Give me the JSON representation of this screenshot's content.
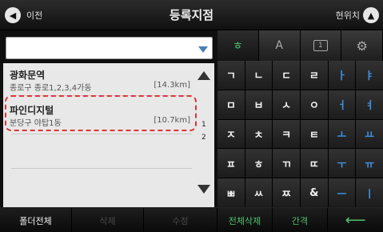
{
  "header": {
    "back_label": "이전",
    "title": "등록지점",
    "current_pos_label": "현위치"
  },
  "search": {
    "value": ""
  },
  "list": {
    "items": [
      {
        "name": "광화문역",
        "address": "종로구 종로1,2,3,4가동",
        "distance": "[14.3km]"
      },
      {
        "name": "파인디지털",
        "address": "분당구 야탑1동",
        "distance": "[10.7km]"
      }
    ],
    "page_current": "1",
    "page_total": "2"
  },
  "keyboard": {
    "tabs": [
      "ㅎ",
      "A",
      "1",
      "gear"
    ],
    "rows": [
      [
        "ㄱ",
        "ㄴ",
        "ㄷ",
        "ㄹ",
        "ㅏ",
        "ㅑ"
      ],
      [
        "ㅁ",
        "ㅂ",
        "ㅅ",
        "ㅇ",
        "ㅓ",
        "ㅕ"
      ],
      [
        "ㅈ",
        "ㅊ",
        "ㅋ",
        "ㅌ",
        "ㅗ",
        "ㅛ"
      ],
      [
        "ㅍ",
        "ㅎ",
        "ㄲ",
        "ㄸ",
        "ㅜ",
        "ㅠ"
      ],
      [
        "ㅃ",
        "ㅆ",
        "ㅉ",
        "&",
        "ㅡ",
        "ㅣ"
      ]
    ]
  },
  "bottom": {
    "folder_all": "폴더전체",
    "delete": "삭제",
    "edit": "수정",
    "delete_all": "전체삭제",
    "space": "간격"
  },
  "colors": {
    "accent_green": "#4fc36d",
    "vowel_blue": "#3f8fe0",
    "highlight_red": "#e03333"
  }
}
